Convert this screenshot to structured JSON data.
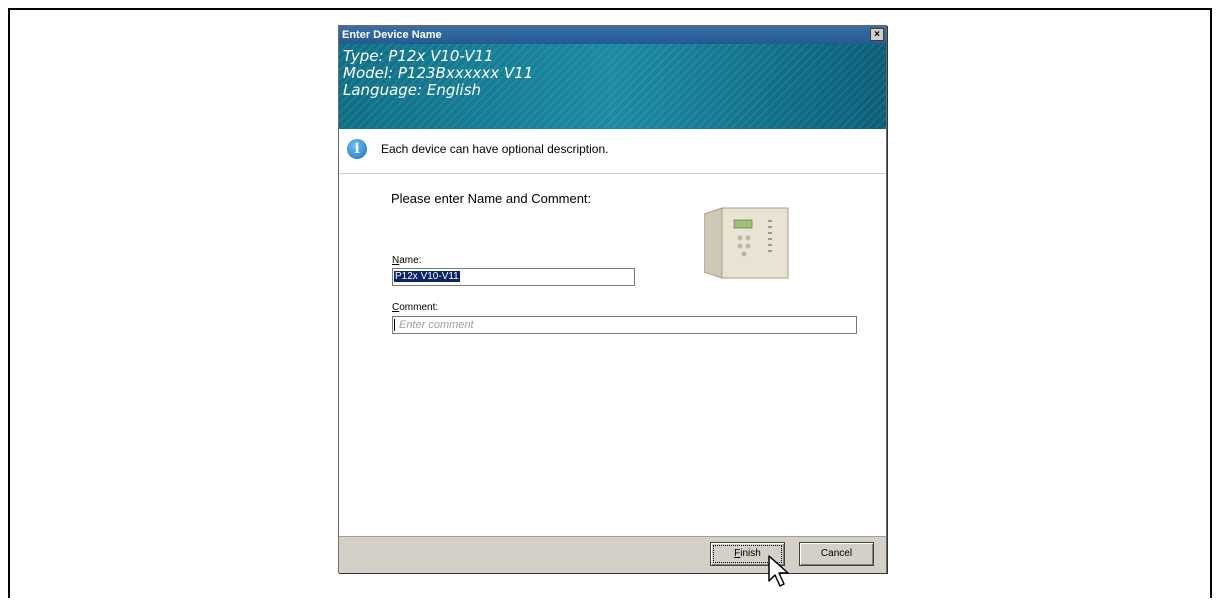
{
  "dialog": {
    "title": "Enter Device Name",
    "close_symbol": "×"
  },
  "banner": {
    "type_line": "Type: P12x V10-V11",
    "model_line": "Model: P123Bxxxxxx V11",
    "language_line": "Language: English"
  },
  "info": {
    "icon": "info-icon",
    "text": "Each device can have optional description."
  },
  "form": {
    "prompt": "Please enter Name and Comment:",
    "name_label_first": "N",
    "name_label_rest": "ame:",
    "name_value": "P12x V10-V11",
    "comment_label_first": "C",
    "comment_label_rest": "omment:",
    "comment_placeholder": "Enter comment"
  },
  "buttons": {
    "finish_first": "F",
    "finish_rest": "inish",
    "cancel": "Cancel"
  }
}
